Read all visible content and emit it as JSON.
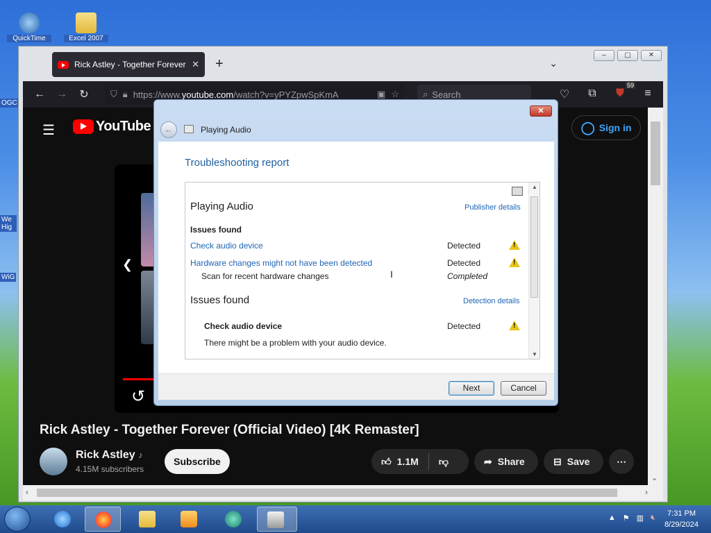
{
  "desktop": {
    "icons": [
      {
        "label": "QuickTime"
      },
      {
        "label": "Excel 2007"
      }
    ],
    "edge_labels": [
      "OGC",
      "We Hig",
      "WiG"
    ]
  },
  "browser": {
    "tab_title": "Rick Astley - Together Forever (",
    "new_tab": "+",
    "url_host_prefix": "https://www.",
    "url_host": "youtube.com",
    "url_path": "/watch?v=yPYZpwSpKmA",
    "search_placeholder": "Search",
    "extension_badge": "59",
    "window_controls": [
      "–",
      "▢",
      "✕"
    ]
  },
  "youtube": {
    "logo_text": "YouTube",
    "sign_in": "Sign in",
    "video_title": "Rick Astley - Together Forever (Official Video) [4K Remaster]",
    "channel_name": "Rick Astley",
    "channel_subs": "4.15M subscribers",
    "subscribe": "Subscribe",
    "likes": "1.1M",
    "share": "Share",
    "save": "Save"
  },
  "dialog": {
    "app_title": "Playing Audio",
    "report_title": "Troubleshooting report",
    "section1_title": "Playing Audio",
    "publisher_details": "Publisher details",
    "issues_found_label": "Issues found",
    "issue1": "Check audio device",
    "issue1_status": "Detected",
    "issue2": "Hardware changes might not have been detected",
    "issue2_status": "Detected",
    "issue2_sub": "Scan for recent hardware changes",
    "issue2_sub_status": "Completed",
    "section2_title": "Issues found",
    "detection_details": "Detection details",
    "detail1": "Check audio device",
    "detail1_status": "Detected",
    "detail1_desc": "There might be a problem with your audio device.",
    "next": "Next",
    "cancel": "Cancel"
  },
  "taskbar": {
    "time": "7:31 PM",
    "date": "8/29/2024"
  }
}
